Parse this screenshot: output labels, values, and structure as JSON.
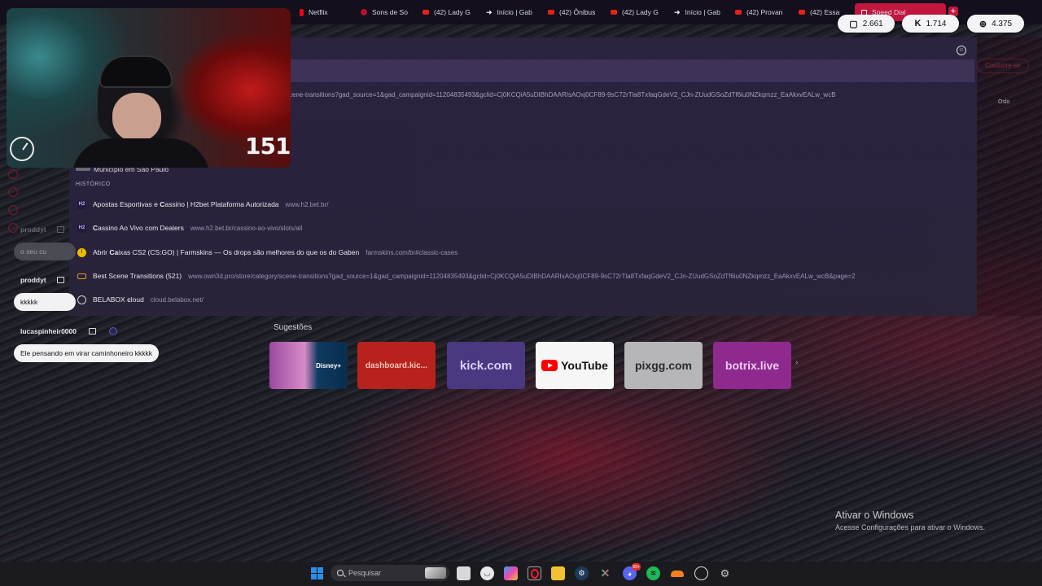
{
  "tabs": [
    {
      "label": "Netflix",
      "icon": "netflix-icon"
    },
    {
      "label": "Sons de So",
      "icon": "record-icon"
    },
    {
      "label": "(42) Lady G",
      "icon": "youtube-icon"
    },
    {
      "label": "Início | Gab",
      "icon": "kick-icon"
    },
    {
      "label": "(42) Ônibus",
      "icon": "youtube-icon"
    },
    {
      "label": "(42) Lady G",
      "icon": "youtube-icon"
    },
    {
      "label": "Início | Gab",
      "icon": "kick-icon"
    },
    {
      "label": "(42) Provan",
      "icon": "youtube-icon"
    },
    {
      "label": "(42) Essa",
      "icon": "youtube-icon"
    },
    {
      "label": "Speed Dial",
      "icon": "speed-dial-icon",
      "active": true
    }
  ],
  "stats": {
    "twitch_viewers": "2.661",
    "kick_viewers": "1.714",
    "total_viewers": "4.375"
  },
  "webcam": {
    "counter": "151"
  },
  "address_dropdown": {
    "top_url": "cene-transitions?gad_source=1&gad_campaignid=11204835493&gclid=Cj0KCQiA5uDIBhDAARIsAOxj0CF89-9sC72rTla8TxfaqGdeV2_CJn-ZUudGSoZdTf6iu0NZkqmzz_EaAkxvEALw_wcB",
    "partial_row": "Município em São Paulo",
    "section_label": "HISTÓRICO",
    "history": [
      {
        "prefix": "Apostas Esportivas e ",
        "bold": "C",
        "rest": "assino | H2bet Plataforma Autorizada",
        "url": "www.h2.bet.br/",
        "icon": "h2"
      },
      {
        "prefix": "",
        "bold": "C",
        "rest": "assino Ao Vivo com Dealers",
        "url": "www.h2.bet.br/cassino-ao-vivo/slots/all",
        "icon": "h2"
      },
      {
        "prefix": "Abrir ",
        "bold": "Ca",
        "rest": "ixas CS2 (CS:GO) | Farmskins — Os drops são melhores do que os do Gaben",
        "url": "farmskins.com/br#classic-cases",
        "icon": "fs"
      },
      {
        "prefix": "Best Scene Transitions (521)",
        "bold": "",
        "rest": "",
        "url": "www.own3d.pro/store/category/scene-transitions?gad_source=1&gad_campaignid=11204835493&gclid=Cj0KCQiA5uDIBhDAARIsAOxj0CF89-9sC72rTla8TxfaqGdeV2_CJn-ZUudGSoZdTf6iu0NZkqmzz_EaAkxvEALw_wcB&page=2",
        "icon": "own"
      },
      {
        "prefix": "BELABOX ",
        "bold": "c",
        "rest": "loud",
        "url": "cloud.belabox.net/",
        "icon": "globe"
      }
    ]
  },
  "ghost": {
    "button_label": "Cadastre-se",
    "weather_city": "Oslo"
  },
  "chat": [
    {
      "user": "proddyt",
      "message": "o seu cu",
      "dim": true
    },
    {
      "user": "proddyt",
      "message": "kkkkk",
      "dim": false
    },
    {
      "user": "lucaspinheir0000",
      "message": "Ele pensando em virar caminhoneiro kkkkk",
      "dim": false
    }
  ],
  "suggestions": {
    "title": "Sugestões",
    "tiles": [
      {
        "label": "",
        "icon": "disney-plus"
      },
      {
        "label": "dashboard.kic..."
      },
      {
        "label": "kick.com"
      },
      {
        "label": "YouTube"
      },
      {
        "label": "pixgg.com"
      },
      {
        "label": "botrix.live"
      }
    ],
    "disney_logo_text": "Disney+"
  },
  "windows_watermark": {
    "title": "Ativar o Windows",
    "subtitle": "Acesse Configurações para ativar o Windows."
  },
  "taskbar": {
    "search_placeholder": "Pesquisar",
    "apps": [
      "file-icon",
      "app-icon",
      "copilot-icon",
      "opera-icon",
      "folder-icon",
      "steam-icon",
      "x-icon",
      "discord-icon",
      "spotify-icon",
      "cloud-icon",
      "chrome-icon",
      "settings-icon"
    ],
    "discord_badge": "99+"
  },
  "colors": {
    "accent": "#c3163e",
    "dropdown_bg": "#2a2340",
    "taskbar_bg": "#1b1b1f"
  }
}
